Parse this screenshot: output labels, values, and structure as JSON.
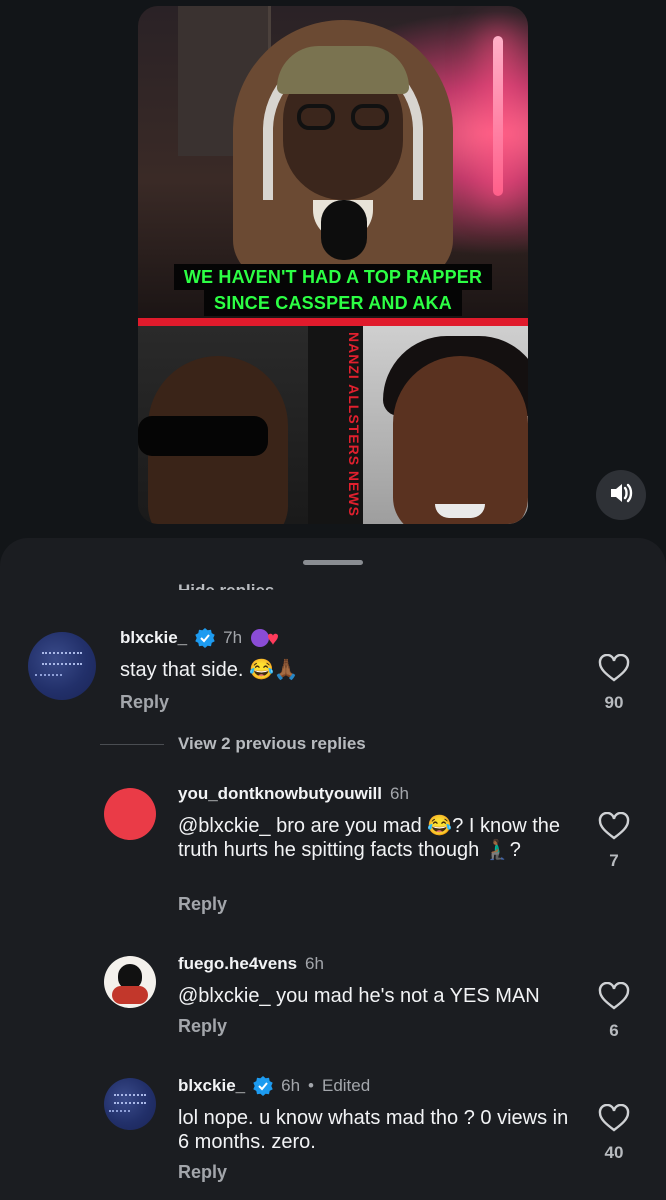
{
  "video": {
    "caption_line1": "WE HAVEN'T HAD A TOP RAPPER",
    "caption_line2": "SINCE CASSPER AND AKA",
    "watermark": "NANZI ALLSTERS NEWS NANZI ALLSTERS NEWS",
    "volume_icon": "volume-on-icon"
  },
  "colors": {
    "caption_text": "#2cff44",
    "accent_red": "#e01b2c",
    "verified_blue": "#1d9bf0",
    "background": "#121518",
    "sheet": "#1b1d21"
  },
  "sheet": {
    "hide_replies": "Hide replies",
    "view_previous": "View 2 previous replies"
  },
  "comments": [
    {
      "username": "blxckie_",
      "verified": true,
      "time": "7h",
      "text": "stay that side. 😂🙏🏾",
      "reply": "Reply",
      "likes": "90"
    },
    {
      "username": "you_dontknowbutyouwill",
      "verified": false,
      "time": "6h",
      "mention": "@blxckie_",
      "text": " bro are you mad 😂? I know the truth hurts he spitting facts though 🧎🏾‍♂️?",
      "reply": "Reply",
      "likes": "7"
    },
    {
      "username": "fuego.he4vens",
      "verified": false,
      "time": "6h",
      "mention": "@blxckie_",
      "text": " you mad he's not a YES MAN",
      "reply": "Reply",
      "likes": "6"
    },
    {
      "username": "blxckie_",
      "verified": true,
      "time": "6h",
      "edited": "Edited",
      "separator": "•",
      "text": "lol nope. u know whats mad tho ? 0 views in 6 months. zero.",
      "reply": "Reply",
      "likes": "40"
    }
  ]
}
